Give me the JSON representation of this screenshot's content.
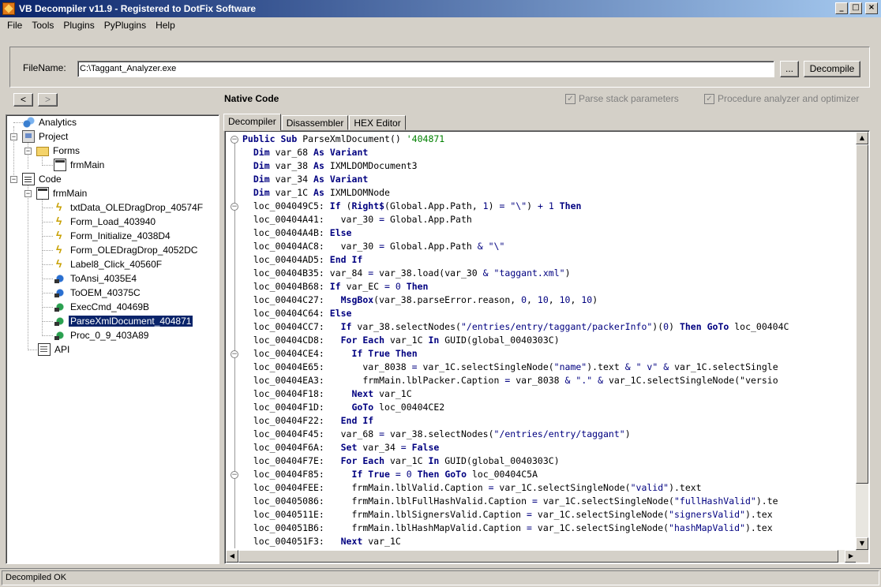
{
  "window": {
    "title": "VB Decompiler v11.9 - Registered to DotFix Software"
  },
  "menu": [
    "File",
    "Tools",
    "Plugins",
    "PyPlugins",
    "Help"
  ],
  "file": {
    "label": "FileName:",
    "value": "C:\\Taggant_Analyzer.exe",
    "browse_label": "...",
    "decompile_label": "Decompile"
  },
  "nav": {
    "back_label": "<",
    "forward_label": ">"
  },
  "header": {
    "section_title": "Native Code",
    "opt_stack": "Parse stack parameters",
    "opt_analyzer": "Procedure analyzer and optimizer"
  },
  "tree": {
    "analytics": "Analytics",
    "project": "Project",
    "forms": "Forms",
    "form_frmmain": "frmMain",
    "code": "Code",
    "code_frmmain": "frmMain",
    "items": [
      {
        "label": "txtData_OLEDragDrop_40574F",
        "icon": "event-icon"
      },
      {
        "label": "Form_Load_403940",
        "icon": "event-icon"
      },
      {
        "label": "Form_Initialize_4038D4",
        "icon": "event-icon"
      },
      {
        "label": "Form_OLEDragDrop_4052DC",
        "icon": "event-icon"
      },
      {
        "label": "Label8_Click_40560F",
        "icon": "event-icon"
      },
      {
        "label": "ToAnsi_4035E4",
        "icon": "procedure-icon"
      },
      {
        "label": "ToOEM_40375C",
        "icon": "procedure-icon"
      },
      {
        "label": "ExecCmd_40469B",
        "icon": "procedure-green-icon"
      },
      {
        "label": "ParseXmlDocument_404871",
        "icon": "procedure-green-icon",
        "selected": true
      },
      {
        "label": "Proc_0_9_403A89",
        "icon": "procedure-green-icon"
      }
    ],
    "api": "API"
  },
  "tabs": [
    "Decompiler",
    "Disassembler",
    "HEX Editor"
  ],
  "code_lines": [
    "Public Sub ParseXmlDocument() '404871",
    "  Dim var_68 As Variant",
    "  Dim var_38 As IXMLDOMDocument3",
    "  Dim var_34 As Variant",
    "  Dim var_1C As IXMLDOMNode",
    "  loc_004049C5: If (Right$(Global.App.Path, 1) = \"\\\") + 1 Then",
    "  loc_00404A41:   var_30 = Global.App.Path",
    "  loc_00404A4B: Else",
    "  loc_00404AC8:   var_30 = Global.App.Path & \"\\\"",
    "  loc_00404AD5: End If",
    "  loc_00404B35: var_84 = var_38.load(var_30 & \"taggant.xml\")",
    "  loc_00404B68: If var_EC = 0 Then",
    "  loc_00404C27:   MsgBox(var_38.parseError.reason, 0, 10, 10, 10)",
    "  loc_00404C64: Else",
    "  loc_00404CC7:   If var_38.selectNodes(\"/entries/entry/taggant/packerInfo\")(0) Then GoTo loc_00404C",
    "  loc_00404CD8:   For Each var_1C In GUID(global_0040303C)",
    "  loc_00404CE4:     If True Then",
    "  loc_00404E65:       var_8038 = var_1C.selectSingleNode(\"name\").text & \" v\" & var_1C.selectSingle",
    "  loc_00404EA3:       frmMain.lblPacker.Caption = var_8038 & \".\" & var_1C.selectSingleNode(\"versio",
    "  loc_00404F18:     Next var_1C",
    "  loc_00404F1D:     GoTo loc_00404CE2",
    "  loc_00404F22:   End If",
    "  loc_00404F45:   var_68 = var_38.selectNodes(\"/entries/entry/taggant\")",
    "  loc_00404F6A:   Set var_34 = False",
    "  loc_00404F7E:   For Each var_1C In GUID(global_0040303C)",
    "  loc_00404F85:     If True = 0 Then GoTo loc_00404C5A",
    "  loc_00404FEE:     frmMain.lblValid.Caption = var_1C.selectSingleNode(\"valid\").text",
    "  loc_00405086:     frmMain.lblFullHashValid.Caption = var_1C.selectSingleNode(\"fullHashValid\").te",
    "  loc_0040511E:     frmMain.lblSignersValid.Caption = var_1C.selectSingleNode(\"signersValid\").tex",
    "  loc_004051B6:     frmMain.lblHashMapValid.Caption = var_1C.selectSingleNode(\"hashMapValid\").tex",
    "  loc_004051F3:   Next var_1C"
  ],
  "status": {
    "text": "Decompiled OK"
  }
}
